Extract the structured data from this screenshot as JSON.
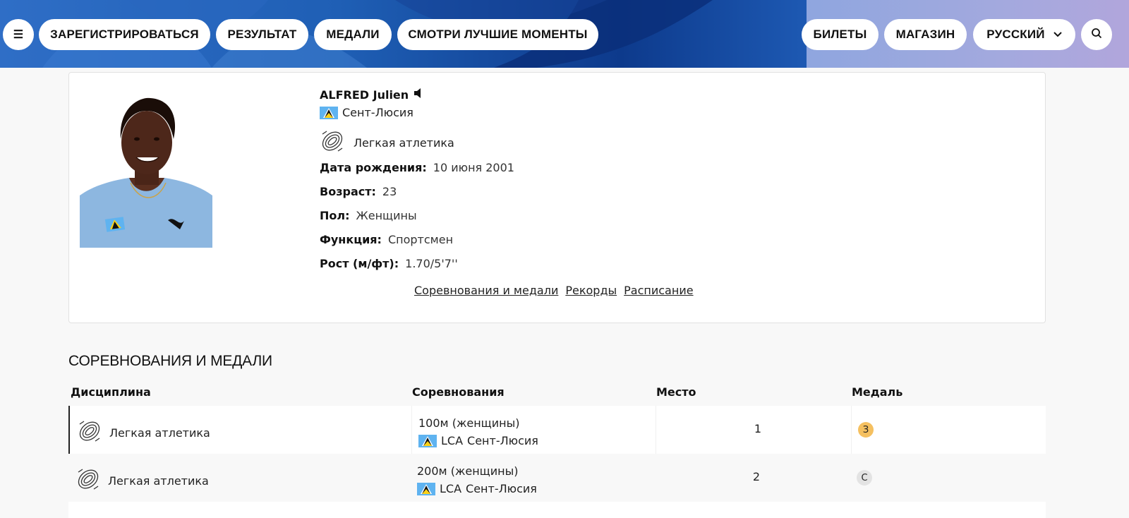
{
  "nav": {
    "left": [
      "ЗАРЕГИСТРИРОВАТЬСЯ",
      "РЕЗУЛЬТАТ",
      "МЕДАЛИ",
      "СМОТРИ ЛУЧШИЕ МОМЕНТЫ"
    ],
    "right": [
      "БИЛЕТЫ",
      "МАГАЗИН"
    ],
    "language": "РУССКИЙ",
    "icons": {
      "menu": "hamburger-icon",
      "search": "search-icon",
      "language": "chevron-down-icon"
    }
  },
  "athlete": {
    "name": "ALFRED Julien",
    "country": "Сент-Люсия",
    "sport": "Легкая атлетика",
    "fields": [
      {
        "label": "Дата рождения:",
        "value": "10 июня 2001"
      },
      {
        "label": "Возраст:",
        "value": "23"
      },
      {
        "label": "Пол:",
        "value": "Женщины"
      },
      {
        "label": "Функция:",
        "value": "Спортсмен"
      },
      {
        "label": "Рост (м/фт):",
        "value": "1.70/5'7''"
      }
    ],
    "links": [
      "Соревнования и медали",
      "Рекорды",
      "Расписание"
    ]
  },
  "medals_section": {
    "title": "СОРЕВНОВАНИЯ И МЕДАЛИ",
    "headers": [
      "Дисциплина",
      "Соревнования",
      "Место",
      "Медаль"
    ],
    "rows": [
      {
        "discipline": "Легкая атлетика",
        "event": "100м (женщины)",
        "noc": "LCA",
        "country": "Сент-Люсия",
        "place": "1",
        "medal": "З",
        "medal_color": "#f5c060"
      },
      {
        "discipline": "Легкая атлетика",
        "event": "200м (женщины)",
        "noc": "LCA",
        "country": "Сент-Люсия",
        "place": "2",
        "medal": "С",
        "medal_color": "#e3e3e3"
      }
    ]
  },
  "colors": {
    "nav_blue": "#1f5fb5",
    "nav_lavender": "#a3a9de",
    "flag_blue": "#5fb3f0",
    "bronze_badge": "#f5c060",
    "silver_badge": "#e3e3e3"
  }
}
